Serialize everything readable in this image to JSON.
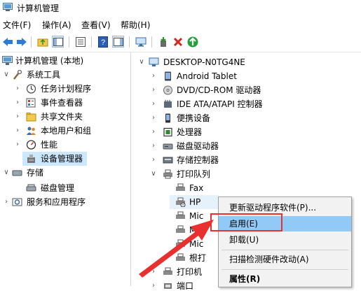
{
  "window": {
    "title": "计算机管理"
  },
  "menu": {
    "file": "文件(F)",
    "action": "操作(A)",
    "view": "查看(V)",
    "help": "帮助(H)"
  },
  "left_tree": {
    "root": "计算机管理 (本地)",
    "system_tools": "系统工具",
    "task_scheduler": "任务计划程序",
    "event_viewer": "事件查看器",
    "shared_folders": "共享文件夹",
    "local_users": "本地用户和组",
    "performance": "性能",
    "device_manager": "设备管理器",
    "storage": "存储",
    "disk_management": "磁盘管理",
    "services": "服务和应用程序"
  },
  "device_tree": {
    "computer": "DESKTOP-N0TG4NE",
    "android": "Android Tablet",
    "dvd": "DVD/CD-ROM 驱动器",
    "ide": "IDE ATA/ATAPI 控制器",
    "portable": "便携设备",
    "processor": "处理器",
    "disk": "磁盘驱动器",
    "storage_ctrl": "存储控制器",
    "print_queue": "打印队列",
    "fax": "Fax",
    "hp": "HP",
    "mic1": "Mic",
    "mic2": "Mic",
    "mic3": "Mic",
    "root_queue": "根打",
    "printer": "打印机",
    "port": "端口"
  },
  "context_menu": {
    "update_driver": "更新驱动程序软件(P)...",
    "enable": "启用(E)",
    "uninstall": "卸载(U)",
    "scan": "扫描检测硬件改动(A)",
    "properties": "属性(R)"
  },
  "colors": {
    "selection": "#cce8ff",
    "highlight": "#91c9f7",
    "annotation_red": "#e8312f"
  }
}
